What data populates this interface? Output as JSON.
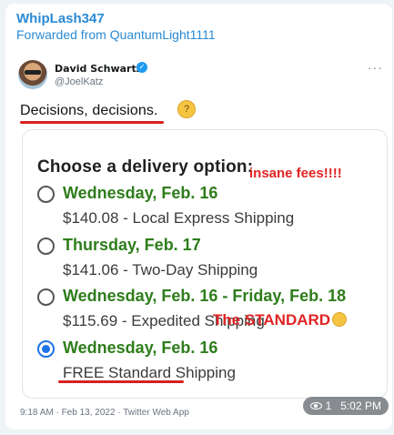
{
  "message": {
    "sender": "WhipLash347",
    "forwarded_from": "Forwarded from QuantumLight1111",
    "views": "1",
    "time": "5:02 PM"
  },
  "tweet": {
    "author_name": "David Schwartz",
    "handle": "@JoelKatz",
    "text": "Decisions, decisions.",
    "footer": "9:18 AM · Feb 13, 2022 · Twitter Web App",
    "more_icon": "ellipsis-icon",
    "verified_icon": "verified-badge-icon"
  },
  "screenshot_card": {
    "title": "Choose a delivery option:",
    "options": [
      {
        "date": "Wednesday, Feb. 16",
        "detail": "$140.08 - Local Express Shipping",
        "selected": false
      },
      {
        "date": "Thursday, Feb. 17",
        "detail": "$141.06 - Two-Day Shipping",
        "selected": false
      },
      {
        "date": "Wednesday, Feb. 16 - Friday, Feb. 18",
        "detail": "$115.69 - Expedited Shipping",
        "selected": false
      },
      {
        "date": "Wednesday, Feb. 16",
        "detail": "FREE Standard Shipping",
        "selected": true
      }
    ],
    "annotation_fees": "insane fees!!!!",
    "annotation_standard": "The STANDARD"
  },
  "colors": {
    "accent_blue": "#2a8ad4",
    "date_green": "#2e7d1b",
    "annotation_red": "#e02424",
    "radio_selected": "#1d73e8"
  }
}
